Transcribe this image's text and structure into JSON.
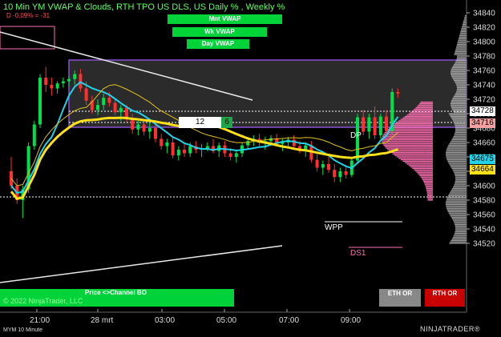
{
  "chart": {
    "title": "10 Min YM VWAP & Clouds, RTH TPO US DLS, US Daily % , Weekly %",
    "subtitle": "D -0,09% = -31"
  },
  "vwap_buttons": {
    "month": "Mnt VWAP",
    "week": "Wk VWAP",
    "day": "Day VWAP"
  },
  "order_input": {
    "value": "12",
    "button": "6"
  },
  "annotations": {
    "dp": "DP",
    "wpp": "WPP",
    "ds1": "DS1"
  },
  "status_bar": {
    "label": "Price <>Channel BO",
    "copyright": "© 2022 NinjaTrader, LLC"
  },
  "or_buttons": {
    "eth": "ETH OR",
    "rth": "RTH OR"
  },
  "price_axis": [
    "34840",
    "34820",
    "34800",
    "34780",
    "34760",
    "34740",
    "34720",
    "34700",
    "34680",
    "34660",
    "34640",
    "34620",
    "34600",
    "34580",
    "34560",
    "34540",
    "34520"
  ],
  "price_labels": {
    "current": "34728",
    "level_a": "34716",
    "level_b": "34675",
    "level_c": "34664",
    "top": "34840"
  },
  "time_axis": [
    "21:00",
    "28 mrt",
    "03:00",
    "05:00",
    "07:00",
    "09:00"
  ],
  "footer": {
    "instrument": "MYM 10 Minute",
    "brand": "NINJATRADER®"
  },
  "colors": {
    "bull_candle": "#00e04a",
    "bear_candle": "#ff3030",
    "vwap_cyan": "#22d3e8",
    "vwap_yellow": "#ffe01a",
    "profile": "#ff6fb1",
    "accent_green": "#00d23a"
  },
  "chart_data": {
    "type": "candlestick",
    "title": "10 Min YM VWAP & Clouds, RTH TPO US DLS, US Daily % , Weekly %",
    "ylim": [
      34520,
      34850
    ],
    "x": [
      "21:00",
      "28 mrt",
      "03:00",
      "05:00",
      "07:00",
      "09:00"
    ],
    "candles": [
      [
        34620,
        34640,
        34595,
        34600
      ],
      [
        34600,
        34610,
        34575,
        34580
      ],
      [
        34580,
        34600,
        34555,
        34595
      ],
      [
        34595,
        34660,
        34590,
        34655
      ],
      [
        34655,
        34690,
        34650,
        34685
      ],
      [
        34685,
        34755,
        34680,
        34750
      ],
      [
        34750,
        34765,
        34730,
        34740
      ],
      [
        34740,
        34750,
        34725,
        34735
      ],
      [
        34735,
        34745,
        34728,
        34742
      ],
      [
        34742,
        34750,
        34736,
        34745
      ],
      [
        34745,
        34752,
        34738,
        34748
      ],
      [
        34748,
        34760,
        34740,
        34755
      ],
      [
        34755,
        34762,
        34730,
        34735
      ],
      [
        34735,
        34745,
        34712,
        34718
      ],
      [
        34718,
        34725,
        34700,
        34705
      ],
      [
        34705,
        34720,
        34698,
        34712
      ],
      [
        34712,
        34728,
        34705,
        34722
      ],
      [
        34722,
        34730,
        34710,
        34715
      ],
      [
        34715,
        34720,
        34698,
        34702
      ],
      [
        34702,
        34712,
        34690,
        34708
      ],
      [
        34708,
        34712,
        34688,
        34692
      ],
      [
        34692,
        34700,
        34672,
        34678
      ],
      [
        34678,
        34690,
        34670,
        34685
      ],
      [
        34685,
        34692,
        34670,
        34675
      ],
      [
        34675,
        34688,
        34665,
        34680
      ],
      [
        34680,
        34685,
        34660,
        34665
      ],
      [
        34665,
        34672,
        34650,
        34655
      ],
      [
        34655,
        34665,
        34645,
        34660
      ],
      [
        34660,
        34668,
        34638,
        34642
      ],
      [
        34642,
        34655,
        34635,
        34650
      ],
      [
        34650,
        34658,
        34640,
        34645
      ],
      [
        34645,
        34660,
        34640,
        34655
      ],
      [
        34655,
        34662,
        34645,
        34650
      ],
      [
        34650,
        34658,
        34640,
        34652
      ],
      [
        34652,
        34660,
        34648,
        34655
      ],
      [
        34655,
        34665,
        34645,
        34648
      ],
      [
        34648,
        34660,
        34640,
        34656
      ],
      [
        34656,
        34662,
        34640,
        34645
      ],
      [
        34645,
        34652,
        34635,
        34640
      ],
      [
        34640,
        34650,
        34632,
        34645
      ],
      [
        34645,
        34660,
        34640,
        34656
      ],
      [
        34656,
        34668,
        34650,
        34662
      ],
      [
        34662,
        34670,
        34655,
        34665
      ],
      [
        34665,
        34672,
        34655,
        34660
      ],
      [
        34660,
        34668,
        34650,
        34662
      ],
      [
        34662,
        34670,
        34655,
        34666
      ],
      [
        34666,
        34672,
        34655,
        34658
      ],
      [
        34658,
        34665,
        34648,
        34660
      ],
      [
        34660,
        34668,
        34652,
        34664
      ],
      [
        34664,
        34670,
        34650,
        34655
      ],
      [
        34655,
        34662,
        34645,
        34648
      ],
      [
        34648,
        34660,
        34640,
        34656
      ],
      [
        34656,
        34662,
        34632,
        34636
      ],
      [
        34636,
        34645,
        34620,
        34625
      ],
      [
        34625,
        34635,
        34615,
        34630
      ],
      [
        34630,
        34640,
        34618,
        34622
      ],
      [
        34622,
        34630,
        34605,
        34612
      ],
      [
        34612,
        34625,
        34605,
        34620
      ],
      [
        34620,
        34628,
        34610,
        34615
      ],
      [
        34615,
        34640,
        34612,
        34635
      ],
      [
        34635,
        34700,
        34630,
        34695
      ],
      [
        34695,
        34705,
        34670,
        34675
      ],
      [
        34675,
        34700,
        34665,
        34695
      ],
      [
        34695,
        34710,
        34665,
        34670
      ],
      [
        34670,
        34700,
        34665,
        34696
      ],
      [
        34696,
        34705,
        34670,
        34676
      ],
      [
        34676,
        34735,
        34672,
        34730
      ],
      [
        34730,
        34735,
        34722,
        34728
      ]
    ],
    "levels": [
      {
        "label": "34728",
        "value": 34728
      },
      {
        "label": "34716",
        "value": 34716
      },
      {
        "label": "34675",
        "value": 34675
      },
      {
        "label": "34664",
        "value": 34664
      }
    ]
  }
}
